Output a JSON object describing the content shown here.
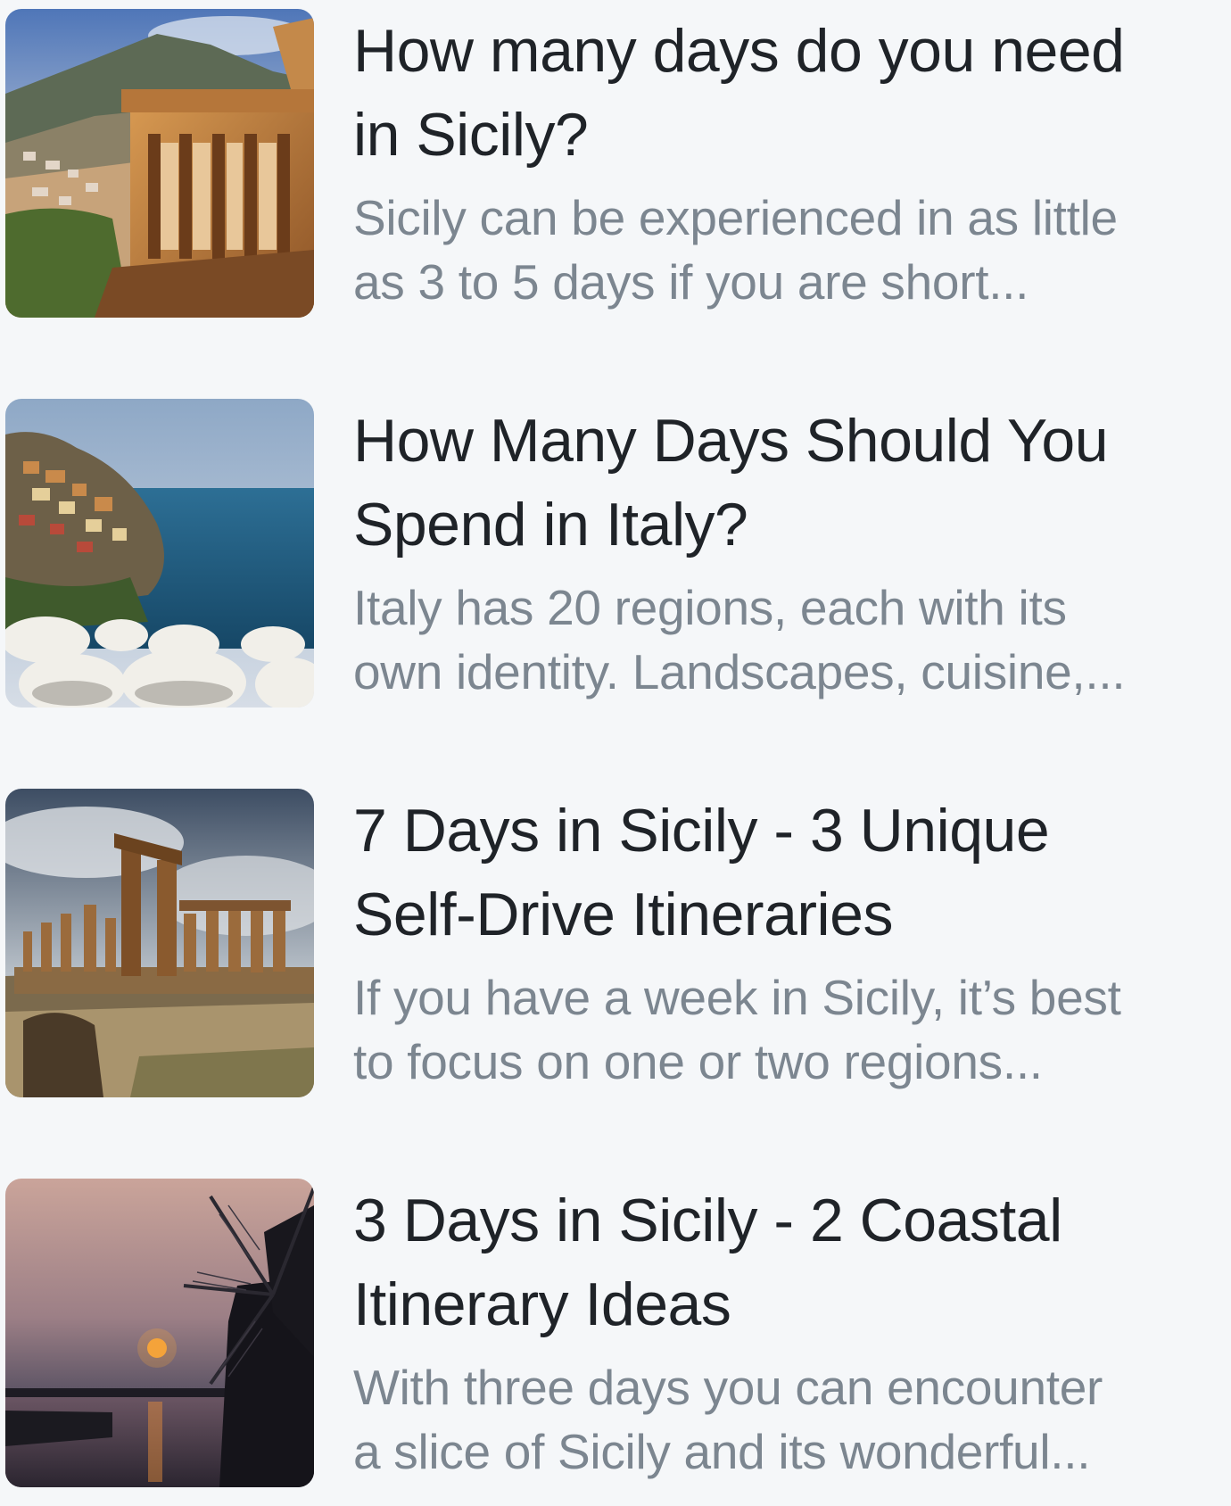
{
  "articles": [
    {
      "title_line1": "How many days do you need",
      "title_line2": "in Sicily?",
      "excerpt_line1": "Sicily can be experienced in as little",
      "excerpt_line2": "as 3 to 5 days if you are short...",
      "image": "taormina-ancient-theater-photo"
    },
    {
      "title_line1": "How Many Days Should You",
      "title_line2": "Spend in Italy?",
      "excerpt_line1": "Italy has 20 regions, each with its",
      "excerpt_line2": "own identity. Landscapes, cuisine,...",
      "image": "cinque-terre-coast-photo"
    },
    {
      "title_line1": "7 Days in Sicily - 3 Unique",
      "title_line2": "Self-Drive Itineraries",
      "excerpt_line1": "If you have a week in Sicily, it’s best",
      "excerpt_line2": "to focus on one or two regions...",
      "image": "agrigento-temple-ruins-photo"
    },
    {
      "title_line1": "3 Days in Sicily - 2 Coastal",
      "title_line2": "Itinerary Ideas",
      "excerpt_line1": "With three days you can encounter",
      "excerpt_line2": "a slice of Sicily and its wonderful...",
      "image": "windmill-sunset-photo"
    }
  ]
}
